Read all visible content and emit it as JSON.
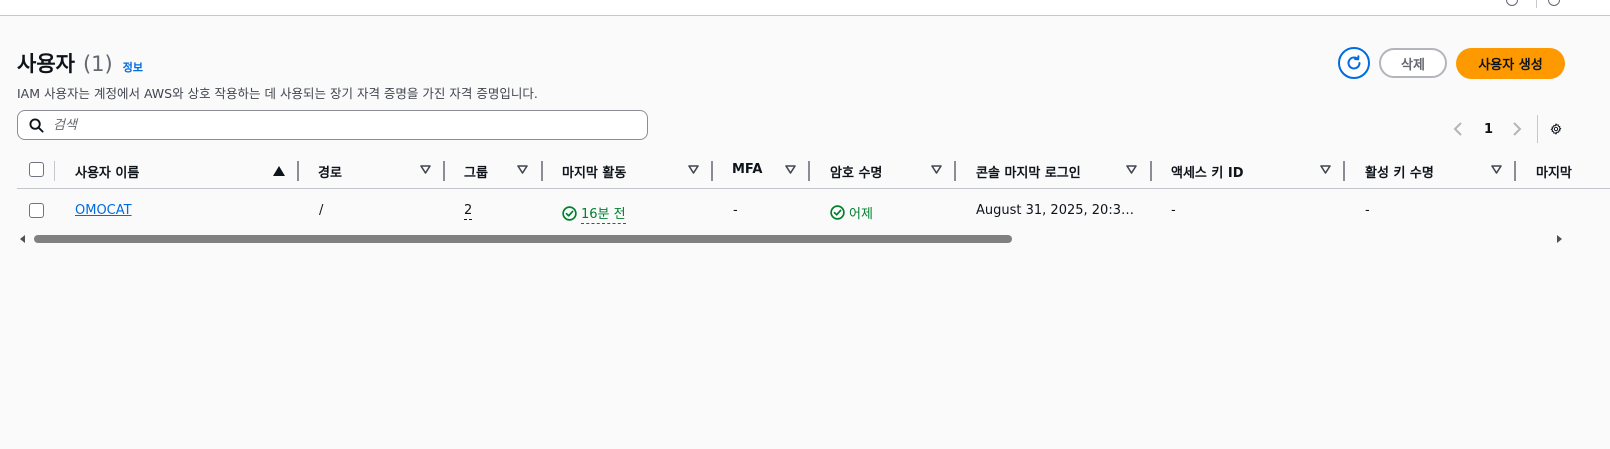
{
  "page": {
    "title": "사용자",
    "count": "(1)",
    "info_link": "정보",
    "description": "IAM 사용자는 계정에서 AWS와 상호 작용하는 데 사용되는 장기 자격 증명을 가진 자격 증명입니다."
  },
  "actions": {
    "refresh_icon": "refresh-icon",
    "delete_label": "삭제",
    "create_label": "사용자 생성"
  },
  "search": {
    "placeholder": "검색",
    "value": ""
  },
  "pagination": {
    "current_page": "1"
  },
  "table": {
    "columns": [
      {
        "label": "사용자 이름",
        "sort": "ascending"
      },
      {
        "label": "경로",
        "sort": "none"
      },
      {
        "label": "그룹",
        "sort": "none"
      },
      {
        "label": "마지막 활동",
        "sort": "none"
      },
      {
        "label": "MFA",
        "sort": "none"
      },
      {
        "label": "암호 수명",
        "sort": "none"
      },
      {
        "label": "콘솔 마지막 로그인",
        "sort": "none"
      },
      {
        "label": "액세스 키 ID",
        "sort": "none"
      },
      {
        "label": "활성 키 수명",
        "sort": "none"
      },
      {
        "label": "마지막",
        "sort": "none"
      }
    ],
    "rows": [
      {
        "user_name": "OMOCAT",
        "path": "/",
        "groups": "2",
        "last_activity": "16분 전",
        "mfa": "-",
        "password_age": "어제",
        "console_last_login": "August 31, 2025, 20:3…",
        "access_key_id": "-",
        "active_key_age": "-"
      }
    ]
  },
  "colors": {
    "link": "#006ce0",
    "primary_button": "#ff9900",
    "success": "#00802f"
  }
}
